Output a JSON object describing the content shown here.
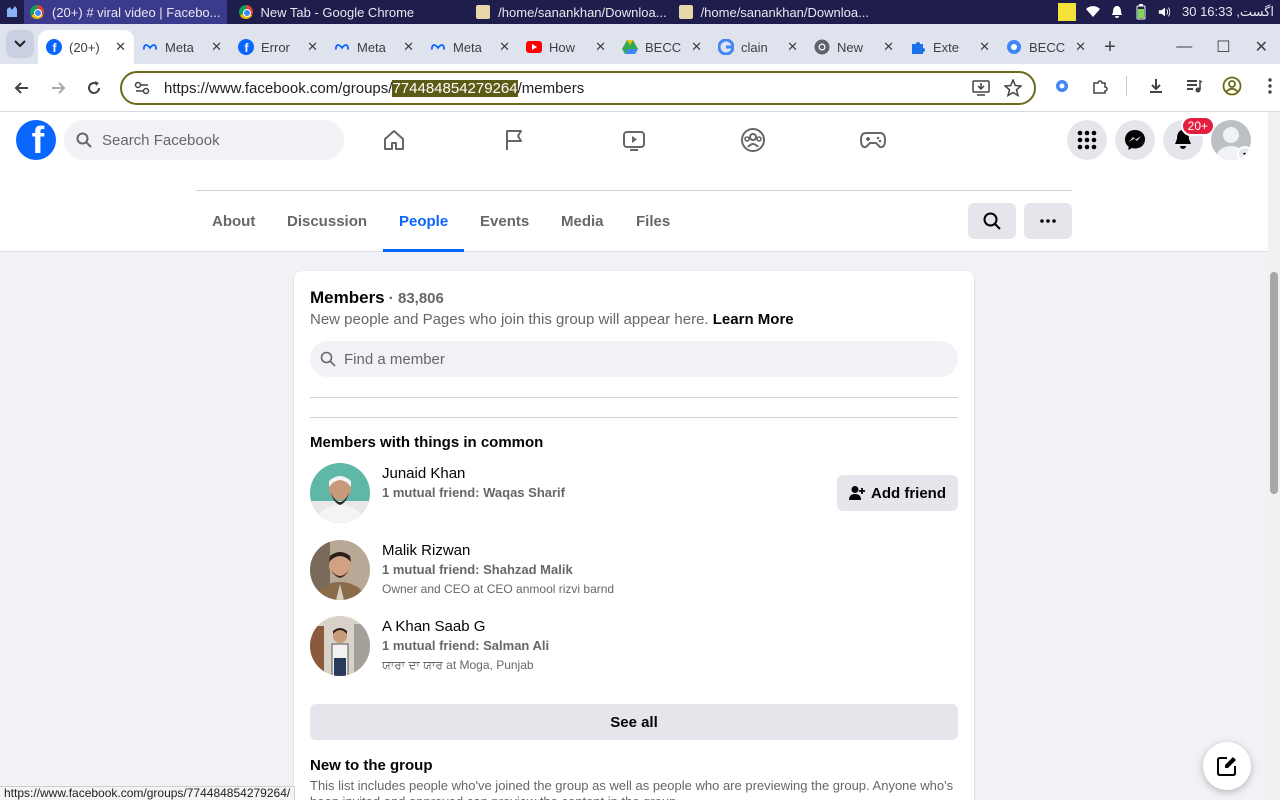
{
  "taskbar": {
    "tasks": [
      {
        "label": "(20+) # viral video | Facebo...",
        "icon": "chrome-icon"
      },
      {
        "label": "New Tab - Google Chrome",
        "icon": "chrome-icon"
      },
      {
        "label": "/home/sanankhan/Downloa...",
        "icon": "folder-icon"
      },
      {
        "label": "/home/sanankhan/Downloa...",
        "icon": "folder-icon"
      }
    ],
    "clock": "30 اگست, 16:33"
  },
  "browser": {
    "tabs": [
      {
        "label": "(20+)",
        "icon": "facebook-icon"
      },
      {
        "label": "Meta",
        "icon": "meta-icon"
      },
      {
        "label": "Error",
        "icon": "facebook-icon"
      },
      {
        "label": "Meta",
        "icon": "meta-icon"
      },
      {
        "label": "Meta",
        "icon": "meta-icon"
      },
      {
        "label": "How",
        "icon": "youtube-icon"
      },
      {
        "label": "BECC",
        "icon": "drive-icon"
      },
      {
        "label": "clain",
        "icon": "google-icon"
      },
      {
        "label": "New",
        "icon": "chrome-icon"
      },
      {
        "label": "Exte",
        "icon": "puzzle-icon"
      },
      {
        "label": "BECC",
        "icon": "globe-icon"
      }
    ],
    "url_prefix": "https://www.facebook.com/groups/",
    "url_highlight": "774484854279264",
    "url_suffix": "/members",
    "status_url": "https://www.facebook.com/groups/774484854279264/"
  },
  "facebook": {
    "search_placeholder": "Search Facebook",
    "notif_count": "20+"
  },
  "group_tabs": [
    "About",
    "Discussion",
    "People",
    "Events",
    "Media",
    "Files"
  ],
  "active_tab": "People",
  "members": {
    "title": "Members",
    "count": " · 83,806",
    "desc": "New people and Pages who join this group will appear here. ",
    "learn_more": "Learn More",
    "find_placeholder": "Find a member",
    "common_title": "Members with things in common",
    "list": [
      {
        "name": "Junaid Khan",
        "mutual": "1 mutual friend: Waqas Sharif",
        "sub": "",
        "action": "Add friend"
      },
      {
        "name": "Malik Rizwan",
        "mutual": "1 mutual friend: Shahzad Malik",
        "sub": "Owner and CEO at CEO anmool rizvi barnd"
      },
      {
        "name": "A Khan Saab G",
        "mutual": "1 mutual friend: Salman Ali",
        "sub": "ਯਾਰਾ ਦਾ ਯਾਰ at Moga, Punjab"
      }
    ],
    "see_all": "See all",
    "new_title": "New to the group",
    "new_desc": "This list includes people who've joined the group as well as people who are previewing the group. Anyone who's been invited and approved can preview the content in the group."
  },
  "colors": {
    "fb_blue": "#0866ff",
    "highlight": "#5c5b16"
  }
}
